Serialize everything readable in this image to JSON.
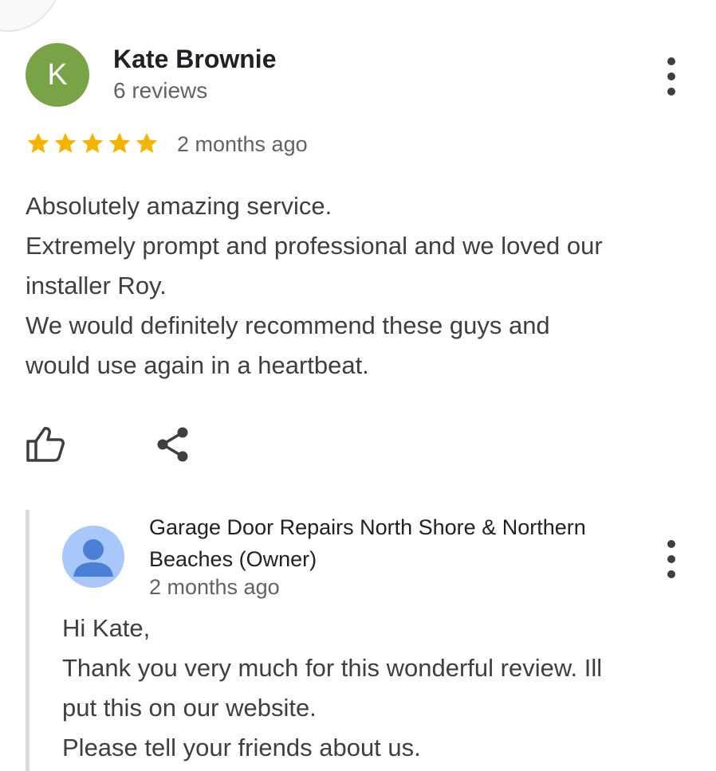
{
  "review": {
    "avatar_letter": "K",
    "reviewer_name": "Kate Brownie",
    "reviewer_count": "6 reviews",
    "rating": 5,
    "rating_max": 5,
    "date": "2 months ago",
    "text_lines": [
      "Absolutely amazing service.",
      "Extremely prompt and professional and we loved our",
      "installer Roy.",
      "We would definitely recommend these guys and",
      "would use again in a heartbeat."
    ]
  },
  "reply": {
    "owner_name": "Garage Door Repairs North Shore & Northern Beaches (Owner)",
    "date": "2 months ago",
    "text_lines": [
      "Hi Kate,",
      "Thank you very much for this wonderful review. Ill",
      "put this on our website.",
      "Please tell your friends about us."
    ]
  },
  "icons": {
    "like": "thumb-up-icon",
    "share": "share-icon",
    "menu": "more-vert-icon",
    "star": "star-icon",
    "owner_avatar": "person-icon"
  },
  "colors": {
    "avatar_bg": "#78a346",
    "star": "#f4b400",
    "owner_avatar_bg": "#a8c7fa",
    "owner_avatar_fg": "#4a7fd6",
    "reply_bar": "#dadce0"
  }
}
